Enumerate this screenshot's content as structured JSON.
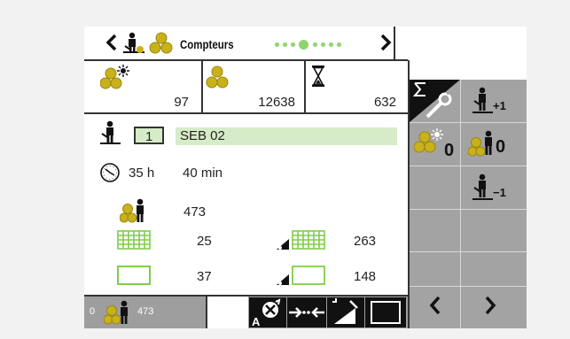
{
  "header": {
    "title": "Compteurs",
    "back_icon": "chevron-left-icon",
    "forward_icon": "chevron-right-icon",
    "page_dots": 7,
    "active_dot": 3
  },
  "counters": {
    "day_bales": "97",
    "total_bales": "12638",
    "hours_value": "632"
  },
  "operator": {
    "number": "1",
    "name": "SEB 02"
  },
  "work_time": {
    "hours": "35 h",
    "minutes": "40 min"
  },
  "stats": {
    "operator_bales": "473",
    "net_bales": "25",
    "net_bales_cut": "263",
    "empty_bales": "37",
    "empty_bales_cut": "148"
  },
  "footer": {
    "left_index": "0",
    "left_count": "473"
  },
  "side_buttons": [
    {
      "name": "settings-button",
      "icon": "sigma-wrench-icon"
    },
    {
      "name": "operator-plus-button",
      "label": "+1"
    },
    {
      "name": "reset-day-bales-button",
      "label": "0"
    },
    {
      "name": "reset-operator-bales-button",
      "label": "0"
    },
    {
      "name": "operator-minus-button",
      "label": "−1"
    },
    {
      "name": "previous-button",
      "icon": "chevron-left-icon"
    },
    {
      "name": "next-button",
      "icon": "chevron-right-icon"
    }
  ],
  "colors": {
    "accent_green": "#8fd46a",
    "bale_yellow": "#c9b11a",
    "name_field": "#d6ecc8",
    "panel_grey": "#a3a3a3"
  }
}
